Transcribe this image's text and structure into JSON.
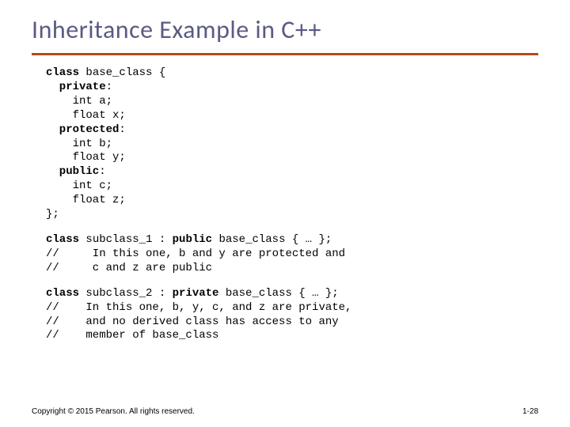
{
  "title": "Inheritance Example in C++",
  "code": {
    "block1": {
      "l1a": "class",
      "l1b": " base_class {",
      "l2a": "  private",
      "l2b": ":",
      "l3": "    int a;",
      "l4": "    float x;",
      "l5a": "  protected",
      "l5b": ":",
      "l6": "    int b;",
      "l7": "    float y;",
      "l8a": "  public",
      "l8b": ":",
      "l9": "    int c;",
      "l10": "    float z;",
      "l11": "};"
    },
    "block2": {
      "l1a": "class",
      "l1b": " subclass_1 : ",
      "l1c": "public",
      "l1d": " base_class { … };",
      "l2": "//     In this one, b and y are protected and",
      "l3": "//     c and z are public"
    },
    "block3": {
      "l1a": "class",
      "l1b": " subclass_2 : ",
      "l1c": "private",
      "l1d": " base_class { … };",
      "l2": "//    In this one, b, y, c, and z are private,",
      "l3": "//    and no derived class has access to any",
      "l4": "//    member of base_class"
    }
  },
  "footer": {
    "copyright": "Copyright © 2015 Pearson. All rights reserved.",
    "page": "1-28"
  }
}
